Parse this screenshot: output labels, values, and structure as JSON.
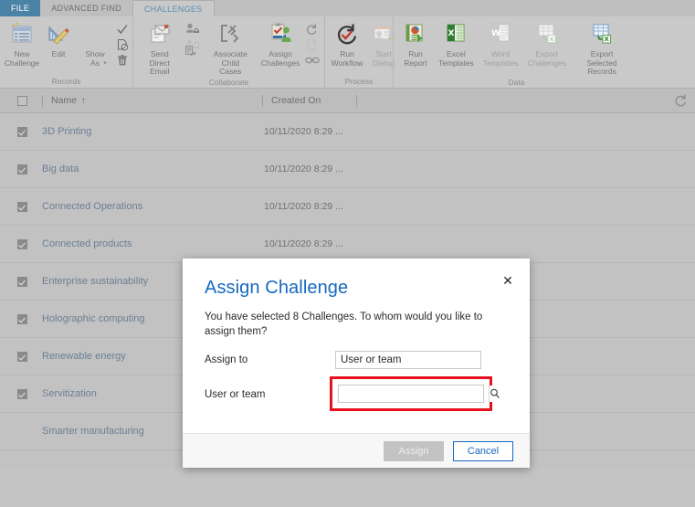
{
  "tabs": [
    {
      "label": "FILE",
      "state": "file"
    },
    {
      "label": "ADVANCED FIND",
      "state": "normal"
    },
    {
      "label": "CHALLENGES",
      "state": "active"
    }
  ],
  "ribbon": {
    "groups": [
      {
        "title": "Records",
        "buttons": [
          {
            "label": "New\nChallenge",
            "icon": "new-record-icon",
            "dim": false
          },
          {
            "label": "Edit",
            "icon": "edit-pencil-ruler-icon",
            "dim": false
          },
          {
            "label": "Show\nAs",
            "icon": "show-as-icon",
            "dim": false,
            "caret": true
          }
        ],
        "small_icons": [
          {
            "icon": "check-icon"
          },
          {
            "icon": "deactivate-document-icon"
          },
          {
            "icon": "delete-trash-icon"
          }
        ]
      },
      {
        "title": "Collaborate",
        "buttons": [
          {
            "label": "Send Direct\nEmail",
            "icon": "send-direct-email-icon",
            "dim": false
          },
          {
            "label": "Associate Child\nCases",
            "icon": "associate-child-cases-icon",
            "dim": false
          },
          {
            "label": "Assign\nChallenges",
            "icon": "assign-challenges-icon",
            "dim": false
          }
        ],
        "small_icons": [
          {
            "icon": "add-connection-icon"
          },
          {
            "icon": "share-users-icon",
            "caret": true
          },
          {
            "icon": "add-to-queue-icon"
          },
          {
            "icon": "workflow-loop-icon"
          },
          {
            "icon": "blank-document-icon"
          },
          {
            "icon": "link-chain-icon"
          }
        ]
      },
      {
        "title": "Process",
        "buttons": [
          {
            "label": "Run\nWorkflow",
            "icon": "run-workflow-icon",
            "dim": false
          },
          {
            "label": "Start\nDialog",
            "icon": "start-dialog-icon",
            "dim": true
          }
        ]
      },
      {
        "title": "Data",
        "buttons": [
          {
            "label": "Run\nReport",
            "icon": "run-report-icon",
            "dim": false,
            "caret": true
          },
          {
            "label": "Excel\nTemplates",
            "icon": "excel-templates-icon",
            "dim": false,
            "caret": true
          },
          {
            "label": "Word\nTemplates",
            "icon": "word-templates-icon",
            "dim": true,
            "caret": true
          },
          {
            "label": "Export\nChallenges",
            "icon": "export-challenges-icon",
            "dim": true,
            "caret": true
          },
          {
            "label": "Export Selected\nRecords",
            "icon": "export-selected-records-icon",
            "dim": false
          }
        ]
      }
    ]
  },
  "grid": {
    "columns": [
      {
        "label": "",
        "key": "select"
      },
      {
        "label": "Name",
        "key": "name",
        "sort": "↑"
      },
      {
        "label": "Created On",
        "key": "created_on"
      }
    ],
    "header_select_all_checked": false,
    "refresh_icon": "refresh-icon",
    "rows": [
      {
        "checked": true,
        "name": "3D Printing",
        "created_on": "10/11/2020 8:29 ..."
      },
      {
        "checked": true,
        "name": "Big data",
        "created_on": "10/11/2020 8:29 ..."
      },
      {
        "checked": true,
        "name": "Connected Operations",
        "created_on": "10/11/2020 8:29 ..."
      },
      {
        "checked": true,
        "name": "Connected products",
        "created_on": "10/11/2020 8:29 ..."
      },
      {
        "checked": true,
        "name": "Enterprise sustainability",
        "created_on": "10/11/2020 8:29 ..."
      },
      {
        "checked": true,
        "name": "Holographic computing",
        "created_on": ""
      },
      {
        "checked": true,
        "name": "Renewable energy",
        "created_on": ""
      },
      {
        "checked": true,
        "name": "Servitization",
        "created_on": ""
      },
      {
        "checked": false,
        "name": "Smarter manufacturing",
        "created_on": ""
      }
    ]
  },
  "dialog": {
    "title": "Assign Challenge",
    "close_icon": "close-icon",
    "message": "You have selected 8 Challenges. To whom would you like to assign them?",
    "fields": [
      {
        "label": "Assign to",
        "value": "User or team",
        "type": "text"
      },
      {
        "label": "User or team",
        "value": "",
        "type": "lookup",
        "lookup_icon": "search-icon",
        "highlighted": true
      }
    ],
    "buttons": [
      {
        "label": "Assign",
        "style": "primary"
      },
      {
        "label": "Cancel",
        "style": "secondary"
      }
    ]
  },
  "colors": {
    "accent_blue": "#1569c0",
    "file_tab_blue": "#4b83a6",
    "highlight_red": "#e8121e",
    "app_background": "#c4c4c4",
    "grid_background": "#c2c2c2",
    "link_text": "#6c7f93"
  }
}
